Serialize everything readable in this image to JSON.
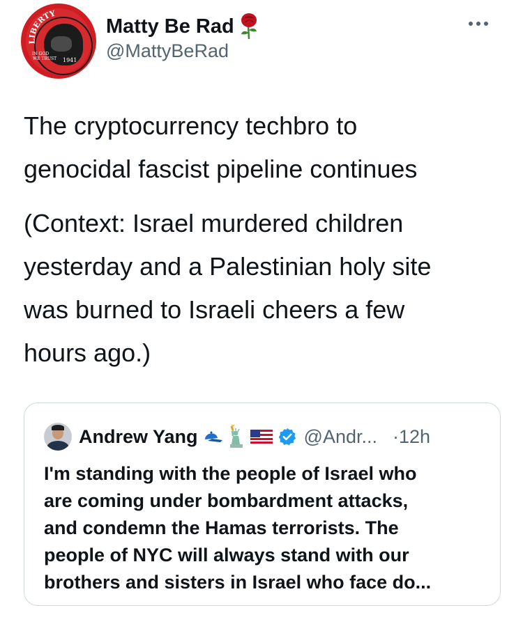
{
  "author": {
    "name": "Matty Be Rad",
    "handle": "@MattyBeRad",
    "avatar_text_top": "LIBERTY",
    "avatar_text_left": "IN GOD WE TRUST",
    "avatar_text_date": "1941"
  },
  "tweet": {
    "paragraph_1": [
      "The cryptocurrency techbro to",
      "genocidal fascist pipeline continues"
    ],
    "paragraph_2": [
      "(Context: Israel murdered children",
      "yesterday and a Palestinian holy site",
      "was burned to Israeli cheers a few",
      "hours ago.)"
    ]
  },
  "quoted_tweet": {
    "name": "Andrew Yang",
    "handle": "@Andr...",
    "separator": "·",
    "time": "12h",
    "verified": true,
    "lines": [
      "I'm standing with the people of Israel who",
      "are coming under bombardment attacks,",
      "and condemn the Hamas terrorists. The",
      "people of NYC will always stand with our",
      "brothers and sisters in Israel who face do..."
    ]
  },
  "colors": {
    "text": "#0f1419",
    "secondary": "#536471",
    "border": "#cfd9de",
    "verified": "#1d9bf0",
    "avatar_red": "#d01d24"
  },
  "icons": {
    "name_emoji": "rose-icon",
    "quoted_emojis": [
      "blue-cap-icon",
      "statue-of-liberty-icon",
      "us-flag-icon",
      "verified-badge-icon"
    ],
    "menu": "more-options-icon"
  }
}
